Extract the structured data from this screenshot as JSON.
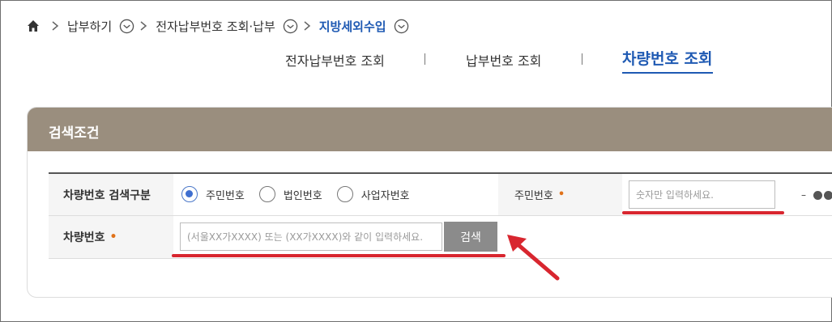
{
  "breadcrumb": {
    "items": [
      "납부하기",
      "전자납부번호 조회·납부",
      "지방세외수입"
    ]
  },
  "tabs": [
    "전자납부번호 조회",
    "납부번호 조회",
    "차량번호 조회"
  ],
  "active_tab_index": 2,
  "panel": {
    "title": "검색조건",
    "row1": {
      "label": "차량번호 검색구분",
      "options": [
        "주민번호",
        "법인번호",
        "사업자번호"
      ],
      "selected_index": 0,
      "id_label": "주민번호",
      "id_placeholder": "숫자만 입력하세요.",
      "dash": "–"
    },
    "row2": {
      "label": "차량번호",
      "placeholder": "(서울XX가XXXX) 또는 (XX가XXXX)와 같이 입력하세요.",
      "search_label": "검색"
    }
  },
  "colors": {
    "accent": "#1f5ab3",
    "header": "#9a8e7e",
    "required": "#e0721a",
    "annotation": "#d8262f"
  }
}
